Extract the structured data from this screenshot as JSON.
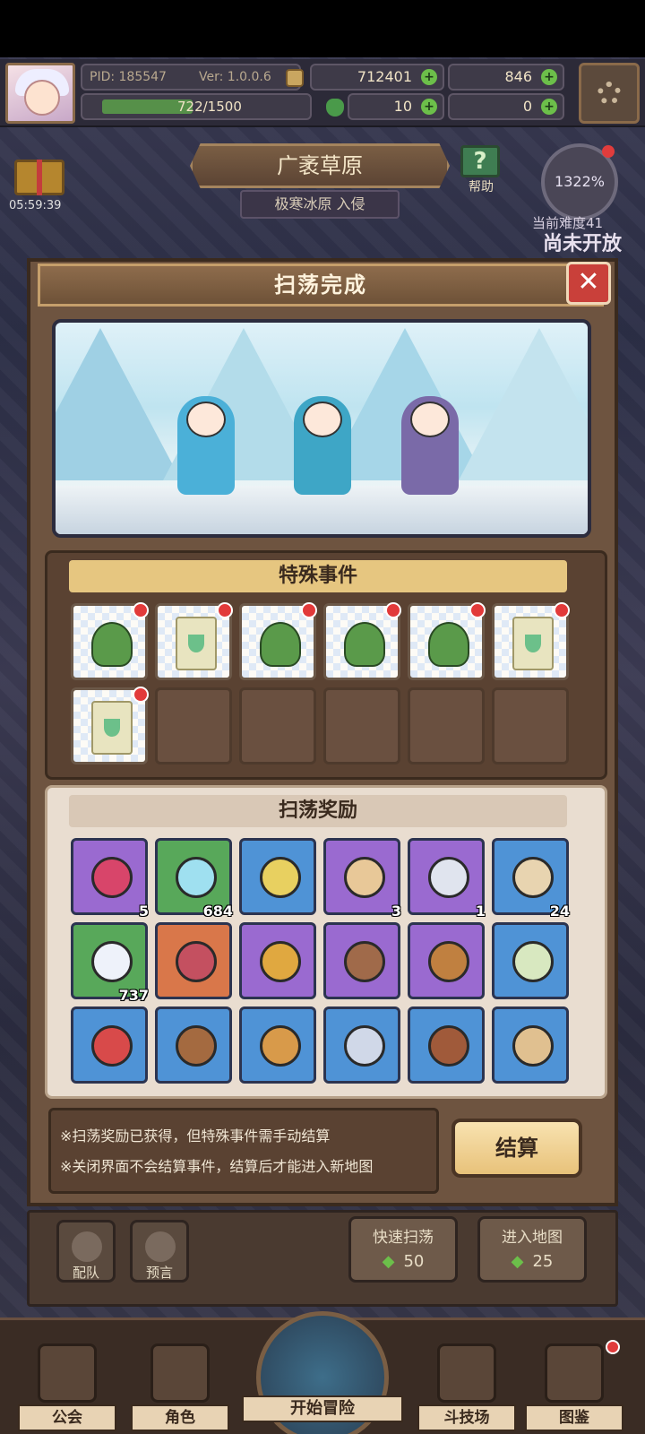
{
  "status": {
    "pid": "PID: 185547",
    "version": "Ver: 1.0.0.6",
    "gold": "712401",
    "gems": "846",
    "exp": "722/1500",
    "exp_progress": 0.481,
    "clover": "10",
    "horn": "0"
  },
  "location": {
    "name": "广袤草原",
    "sub": "极寒冰原 入侵",
    "help_label": "帮助",
    "gift_timer": "05:59:39",
    "difficulty_percent": "1322%",
    "difficulty_label": "当前难度41",
    "not_open": "尚未开放"
  },
  "dialog": {
    "title": "扫荡完成",
    "close": "✕",
    "events_title": "特殊事件",
    "events": [
      {
        "icon": "goblin-icon"
      },
      {
        "icon": "scroll-icon"
      },
      {
        "icon": "goblin-icon"
      },
      {
        "icon": "goblin-icon"
      },
      {
        "icon": "goblin-icon"
      },
      {
        "icon": "scroll-icon"
      },
      {
        "icon": "scroll-icon"
      }
    ],
    "rewards_title": "扫荡奖励",
    "rewards": [
      {
        "icon": "berry-icon",
        "rarity": "purple",
        "qty": "5"
      },
      {
        "icon": "crystal-icon",
        "rarity": "green",
        "qty": "684"
      },
      {
        "icon": "slime-icon",
        "rarity": "blue",
        "qty": ""
      },
      {
        "icon": "shell-icon",
        "rarity": "purple",
        "qty": "3"
      },
      {
        "icon": "ore-icon",
        "rarity": "purple",
        "qty": "1"
      },
      {
        "icon": "bone-icon",
        "rarity": "blue",
        "qty": "24"
      },
      {
        "icon": "diamond-icon",
        "rarity": "green",
        "qty": "737"
      },
      {
        "icon": "flower-ring-icon",
        "rarity": "orange",
        "qty": ""
      },
      {
        "icon": "gold-ring-icon",
        "rarity": "purple",
        "qty": ""
      },
      {
        "icon": "amulet-icon",
        "rarity": "purple",
        "qty": ""
      },
      {
        "icon": "crown-ring-icon",
        "rarity": "purple",
        "qty": ""
      },
      {
        "icon": "bow-icon",
        "rarity": "blue",
        "qty": ""
      },
      {
        "icon": "heart-shield-icon",
        "rarity": "blue",
        "qty": ""
      },
      {
        "icon": "leather-armor-icon",
        "rarity": "blue",
        "qty": ""
      },
      {
        "icon": "gold-armor-icon",
        "rarity": "blue",
        "qty": ""
      },
      {
        "icon": "belt-icon",
        "rarity": "blue",
        "qty": ""
      },
      {
        "icon": "boots-icon",
        "rarity": "blue",
        "qty": ""
      },
      {
        "icon": "necklace-icon",
        "rarity": "blue",
        "qty": ""
      }
    ],
    "notice_1": "※扫荡奖励已获得，但特殊事件需手动结算",
    "notice_2": "※关闭界面不会结算事件，结算后才能进入新地图",
    "settle_label": "结算"
  },
  "lower": {
    "team_label": "配队",
    "prophecy_label": "预言",
    "quick_sweep_label": "快速扫荡",
    "quick_sweep_cost": "50",
    "enter_map_label": "进入地图",
    "enter_map_cost": "25"
  },
  "nav": {
    "guild": "公会",
    "character": "角色",
    "adventure": "开始冒险",
    "arena": "斗技场",
    "codex": "图鉴"
  },
  "colors": {
    "purple": "#9a6ad0",
    "green": "#58a85a",
    "blue": "#4f93d6",
    "orange": "#d9774a"
  }
}
